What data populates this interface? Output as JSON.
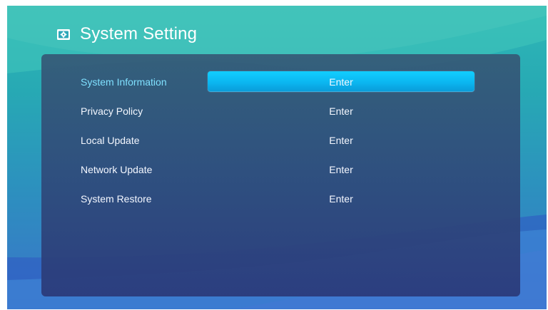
{
  "header": {
    "title": "System Setting",
    "icon": "settings-box-icon"
  },
  "settings": {
    "items": [
      {
        "label": "System Information",
        "action": "Enter",
        "active": true
      },
      {
        "label": "Privacy Policy",
        "action": "Enter",
        "active": false
      },
      {
        "label": "Local Update",
        "action": "Enter",
        "active": false
      },
      {
        "label": "Network Update",
        "action": "Enter",
        "active": false
      },
      {
        "label": "System Restore",
        "action": "Enter",
        "active": false
      }
    ]
  },
  "colors": {
    "active_accent": "#12cfff",
    "active_label": "#7fe0ff",
    "panel": "#314a7a",
    "background_top": "#2fb8b6",
    "background_bottom": "#3b73c9"
  }
}
